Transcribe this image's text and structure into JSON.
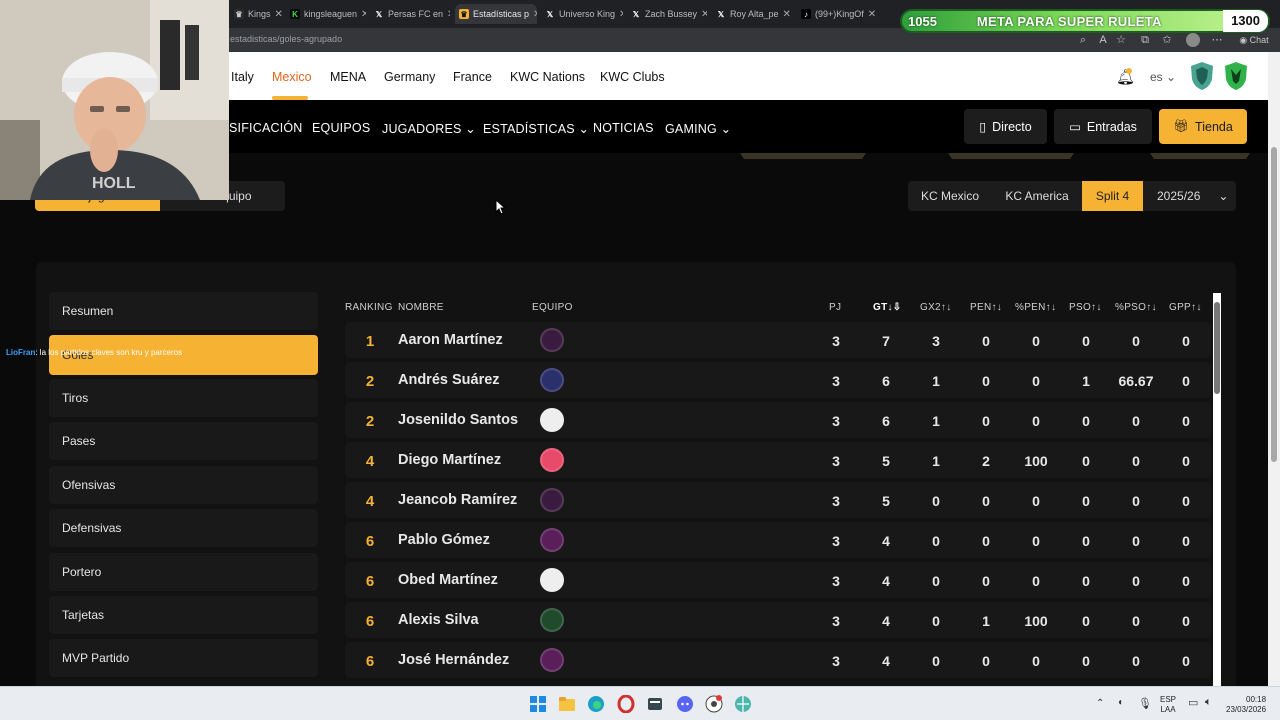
{
  "browser": {
    "tabs": [
      {
        "label": "Kings",
        "active": false
      },
      {
        "label": "kingsleaguen",
        "active": false
      },
      {
        "label": "Persas FC en",
        "active": false
      },
      {
        "label": "Estadísticas p",
        "active": true
      },
      {
        "label": "Universo King",
        "active": false
      },
      {
        "label": "Zach Bussey",
        "active": false
      },
      {
        "label": "Roy Alta_pe",
        "active": false
      },
      {
        "label": "(99+)KingOf",
        "active": false
      }
    ],
    "url": "estadisticas/goles-agrupado",
    "chat_label": "Chat"
  },
  "overlay": {
    "meta_left": "1055",
    "meta_text": "META PARA SUPER RULETA",
    "meta_right": "1300",
    "chat_user": "LioFran",
    "chat_message": ": la los partidos claves son kru y parceros"
  },
  "topnav": {
    "items": [
      "Italy",
      "Mexico",
      "MENA",
      "Germany",
      "France",
      "KWC Nations",
      "KWC Clubs"
    ],
    "active": "Mexico",
    "lang": "es"
  },
  "mainnav": {
    "items": [
      "SIFICACIÓN",
      "EQUIPOS",
      "JUGADORES",
      "ESTADÍSTICAS",
      "NOTICIAS",
      "GAMING"
    ],
    "directo": "Directo",
    "entradas": "Entradas",
    "tienda": "Tienda"
  },
  "toggle": {
    "por_jugador": "Por jugador",
    "por_equipo": "Por equipo"
  },
  "filters": {
    "kc_mexico": "KC Mexico",
    "kc_america": "KC America",
    "split": "Split 4",
    "season": "2025/26"
  },
  "sidebar": {
    "items": [
      "Resumen",
      "Goles",
      "Tiros",
      "Pases",
      "Ofensivas",
      "Defensivas",
      "Portero",
      "Tarjetas",
      "MVP Partido"
    ],
    "active": "Goles"
  },
  "table": {
    "headers": {
      "ranking": "RANKING",
      "nombre": "NOMBRE",
      "equipo": "EQUIPO",
      "pj": "PJ",
      "gt": "GT",
      "gx2": "GX2",
      "pen": "PEN",
      "ppen": "%PEN",
      "pso": "PSO",
      "ppso": "%PSO",
      "gpp": "GPP"
    },
    "rows": [
      {
        "rank": "1",
        "name": "Aaron Martínez",
        "team_color": "#3a1a3e",
        "pj": "3",
        "gt": "7",
        "gx2": "3",
        "pen": "0",
        "ppen": "0",
        "pso": "0",
        "ppso": "0",
        "gpp": "0"
      },
      {
        "rank": "2",
        "name": "Andrés Suárez",
        "team_color": "#2b2f6b",
        "pj": "3",
        "gt": "6",
        "gx2": "1",
        "pen": "0",
        "ppen": "0",
        "pso": "1",
        "ppso": "66.67",
        "gpp": "0"
      },
      {
        "rank": "2",
        "name": "Josenildo Santos",
        "team_color": "#eeeeee",
        "pj": "3",
        "gt": "6",
        "gx2": "1",
        "pen": "0",
        "ppen": "0",
        "pso": "0",
        "ppso": "0",
        "gpp": "0"
      },
      {
        "rank": "4",
        "name": "Diego Martínez",
        "team_color": "#e84a6a",
        "pj": "3",
        "gt": "5",
        "gx2": "1",
        "pen": "2",
        "ppen": "100",
        "pso": "0",
        "ppso": "0",
        "gpp": "0"
      },
      {
        "rank": "4",
        "name": "Jeancob Ramírez",
        "team_color": "#3a1a3e",
        "pj": "3",
        "gt": "5",
        "gx2": "0",
        "pen": "0",
        "ppen": "0",
        "pso": "0",
        "ppso": "0",
        "gpp": "0"
      },
      {
        "rank": "6",
        "name": "Pablo Gómez",
        "team_color": "#5a1f5a",
        "pj": "3",
        "gt": "4",
        "gx2": "0",
        "pen": "0",
        "ppen": "0",
        "pso": "0",
        "ppso": "0",
        "gpp": "0"
      },
      {
        "rank": "6",
        "name": "Obed Martínez",
        "team_color": "#eeeeee",
        "pj": "3",
        "gt": "4",
        "gx2": "0",
        "pen": "0",
        "ppen": "0",
        "pso": "0",
        "ppso": "0",
        "gpp": "0"
      },
      {
        "rank": "6",
        "name": "Alexis Silva",
        "team_color": "#1f4a2c",
        "pj": "3",
        "gt": "4",
        "gx2": "0",
        "pen": "1",
        "ppen": "100",
        "pso": "0",
        "ppso": "0",
        "gpp": "0"
      },
      {
        "rank": "6",
        "name": "José Hernández",
        "team_color": "#5a1f5a",
        "pj": "3",
        "gt": "4",
        "gx2": "0",
        "pen": "0",
        "ppen": "0",
        "pso": "0",
        "ppso": "0",
        "gpp": "0"
      }
    ]
  },
  "taskbar": {
    "lang_top": "ESP",
    "lang_bottom": "LAA",
    "time": "00:18",
    "date": "23/03/2026"
  },
  "colors": {
    "accent": "#f6b233",
    "active_nav": "#e0671d"
  }
}
